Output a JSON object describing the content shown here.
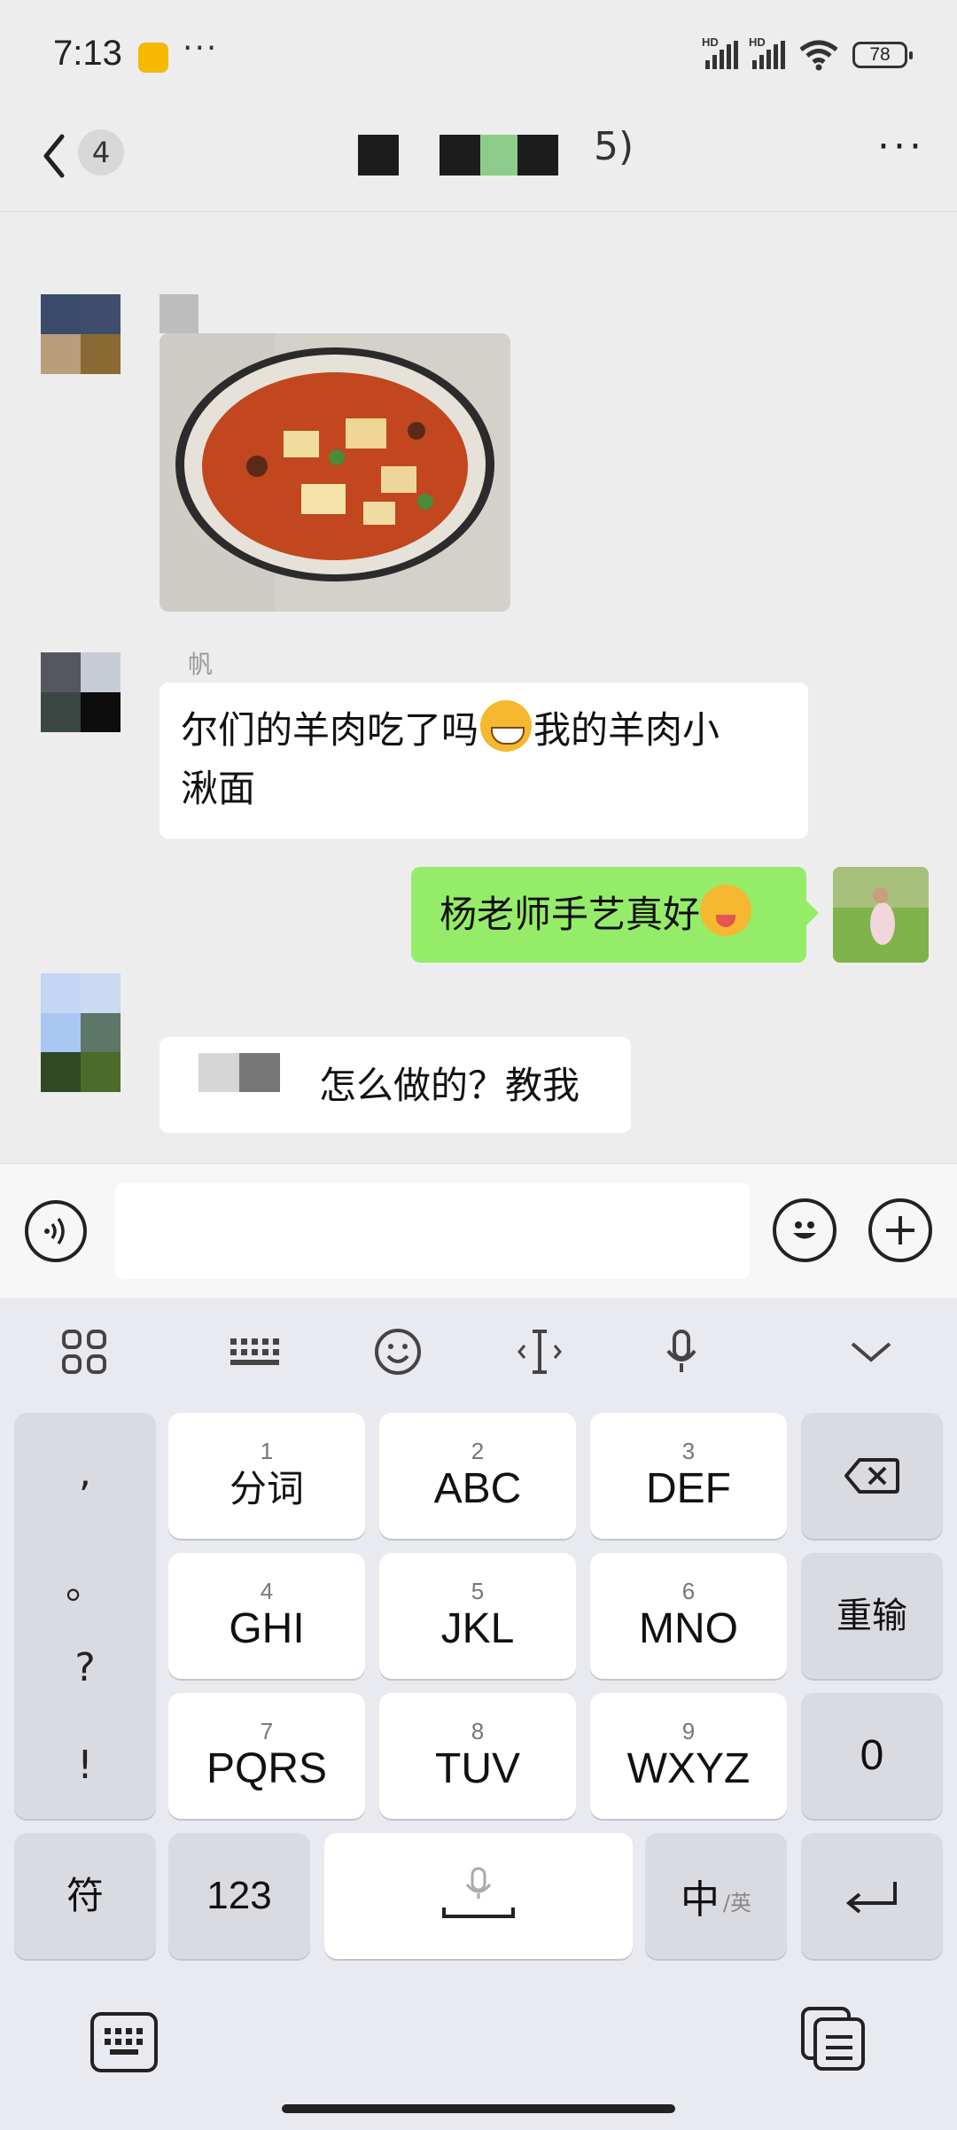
{
  "status_bar": {
    "time": "7:13",
    "dots": "···",
    "network_1": "HD",
    "network_2": "HD",
    "battery": "78"
  },
  "nav": {
    "unread_count": "4",
    "title_suffix": "5)",
    "more": "···"
  },
  "messages": [
    {
      "side": "left",
      "type": "image",
      "image_desc": "bowl-of-food-photo"
    },
    {
      "side": "left",
      "type": "text",
      "text_1": "尔们的羊肉吃了吗",
      "text_2": "我的羊肉小",
      "text_3": "湫面",
      "nick_tail": "帆"
    },
    {
      "side": "right",
      "type": "text",
      "text": "杨老师手艺真好"
    },
    {
      "side": "left",
      "type": "text",
      "text": "怎么做的？教我"
    }
  ],
  "input": {
    "value": "",
    "placeholder": ""
  },
  "keyboard": {
    "toolbar": [
      "apps-grid-icon",
      "keyboard-layout-icon",
      "emoji-icon",
      "cursor-icon",
      "voice-icon",
      "collapse-icon"
    ],
    "punct": [
      ",",
      "。",
      "?",
      "!"
    ],
    "keys": [
      {
        "num": "1",
        "label": "分词"
      },
      {
        "num": "2",
        "label": "ABC"
      },
      {
        "num": "3",
        "label": "DEF"
      },
      {
        "num": "4",
        "label": "GHI"
      },
      {
        "num": "5",
        "label": "JKL"
      },
      {
        "num": "6",
        "label": "MNO"
      },
      {
        "num": "7",
        "label": "PQRS"
      },
      {
        "num": "8",
        "label": "TUV"
      },
      {
        "num": "9",
        "label": "WXYZ"
      }
    ],
    "reinput": "重输",
    "zero": "0",
    "symbols": "符",
    "numbers": "123",
    "lang_main": "中",
    "lang_alt": "/英"
  }
}
